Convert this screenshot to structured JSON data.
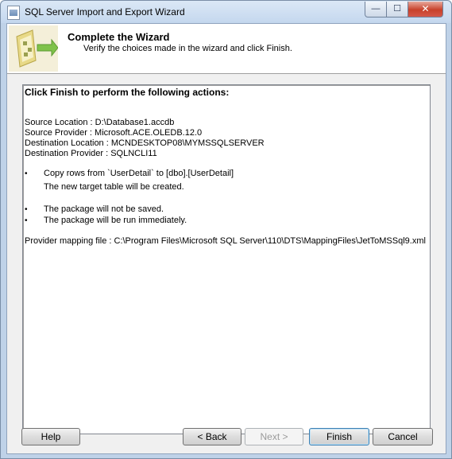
{
  "window": {
    "title": "SQL Server Import and Export Wizard",
    "controls": {
      "minimize": "—",
      "maximize": "☐",
      "close": "✕"
    }
  },
  "header": {
    "title": "Complete the Wizard",
    "subtitle": "Verify the choices made in the wizard and click Finish.",
    "icon": "wizard-icon"
  },
  "report": {
    "heading": "Click Finish to perform the following actions:",
    "details": [
      "Source Location : D:\\Database1.accdb",
      "Source Provider : Microsoft.ACE.OLEDB.12.0",
      "Destination Location : MCNDESKTOP08\\MYMSSQLSERVER",
      "Destination Provider : SQLNCLI11"
    ],
    "copy_action": "Copy rows from `UserDetail` to [dbo].[UserDetail]",
    "copy_note": "The new target table will be created.",
    "package_notes": [
      "The package will not be saved.",
      "The package will be run immediately."
    ],
    "mapping_file": "Provider mapping file : C:\\Program Files\\Microsoft SQL Server\\110\\DTS\\MappingFiles\\JetToMSSql9.xml",
    "bullet_glyph": "•"
  },
  "buttons": {
    "help": "Help",
    "back": "< Back",
    "next": "Next >",
    "finish": "Finish",
    "cancel": "Cancel"
  },
  "colors": {
    "title_bar": "#c4d7ee",
    "close_button": "#c8412a",
    "dialog_bg": "#f0f0f0"
  }
}
